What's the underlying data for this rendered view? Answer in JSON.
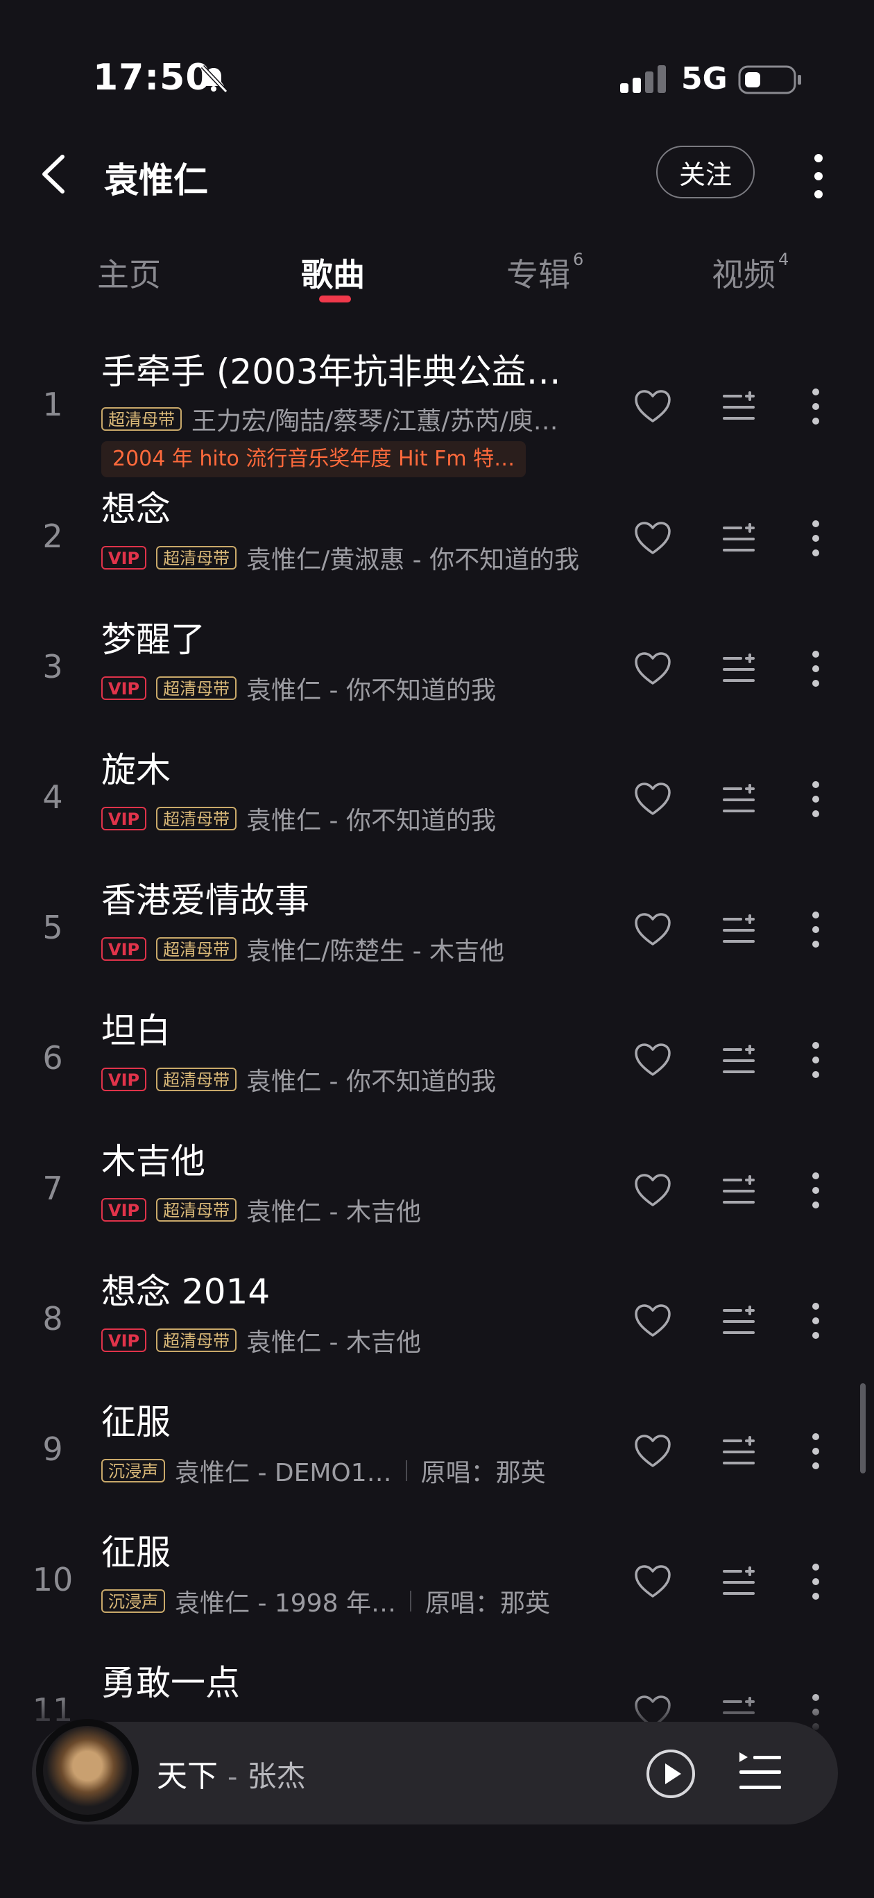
{
  "status_bar": {
    "time": "17:50",
    "network": "5G"
  },
  "header": {
    "artist": "袁惟仁",
    "follow_label": "关注"
  },
  "tabs": [
    {
      "label": "主页",
      "count": ""
    },
    {
      "label": "歌曲",
      "count": ""
    },
    {
      "label": "专辑",
      "count": "6"
    },
    {
      "label": "视频",
      "count": "4"
    }
  ],
  "active_tab": "歌曲",
  "songs": [
    {
      "num": "1",
      "title": "手牵手 (2003年抗非典公益…",
      "badges": [
        "超清母带"
      ],
      "meta": "王力宏/陶喆/蔡琴/江蕙/苏芮/庾…",
      "note": "2004 年 hito 流行音乐奖年度 Hit Fm 特…"
    },
    {
      "num": "2",
      "title": "想念",
      "badges": [
        "VIP",
        "超清母带"
      ],
      "meta": "袁惟仁/黄淑惠 - 你不知道的我"
    },
    {
      "num": "3",
      "title": "梦醒了",
      "badges": [
        "VIP",
        "超清母带"
      ],
      "meta": "袁惟仁 - 你不知道的我"
    },
    {
      "num": "4",
      "title": "旋木",
      "badges": [
        "VIP",
        "超清母带"
      ],
      "meta": "袁惟仁 - 你不知道的我"
    },
    {
      "num": "5",
      "title": "香港爱情故事",
      "badges": [
        "VIP",
        "超清母带"
      ],
      "meta": "袁惟仁/陈楚生 - 木吉他"
    },
    {
      "num": "6",
      "title": "坦白",
      "badges": [
        "VIP",
        "超清母带"
      ],
      "meta": "袁惟仁 - 你不知道的我"
    },
    {
      "num": "7",
      "title": "木吉他",
      "badges": [
        "VIP",
        "超清母带"
      ],
      "meta": "袁惟仁 - 木吉他"
    },
    {
      "num": "8",
      "title": "想念 2014",
      "badges": [
        "VIP",
        "超清母带"
      ],
      "meta": "袁惟仁 - 木吉他"
    },
    {
      "num": "9",
      "title": "征服",
      "badges": [
        "沉浸声"
      ],
      "meta": "袁惟仁 - DEMO1…",
      "original": "原唱：那英"
    },
    {
      "num": "10",
      "title": "征服",
      "badges": [
        "沉浸声"
      ],
      "meta": "袁惟仁 - 1998 年…",
      "original": "原唱：那英"
    },
    {
      "num": "11",
      "title": "勇敢一点",
      "badges": [],
      "meta": ""
    }
  ],
  "now_playing": {
    "title": "天下",
    "separator": "-",
    "artist": "张杰"
  },
  "icons": {
    "back": "chevron-left-icon",
    "more": "more-vertical-icon",
    "heart": "heart-outline-icon",
    "queue": "add-to-queue-icon",
    "play": "play-circle-icon",
    "playlist": "playlist-icon"
  },
  "colors": {
    "accent": "#f0394b",
    "vip": "#e0334a",
    "hq_badge": "#d9b878",
    "note": "#ff6a3c"
  }
}
